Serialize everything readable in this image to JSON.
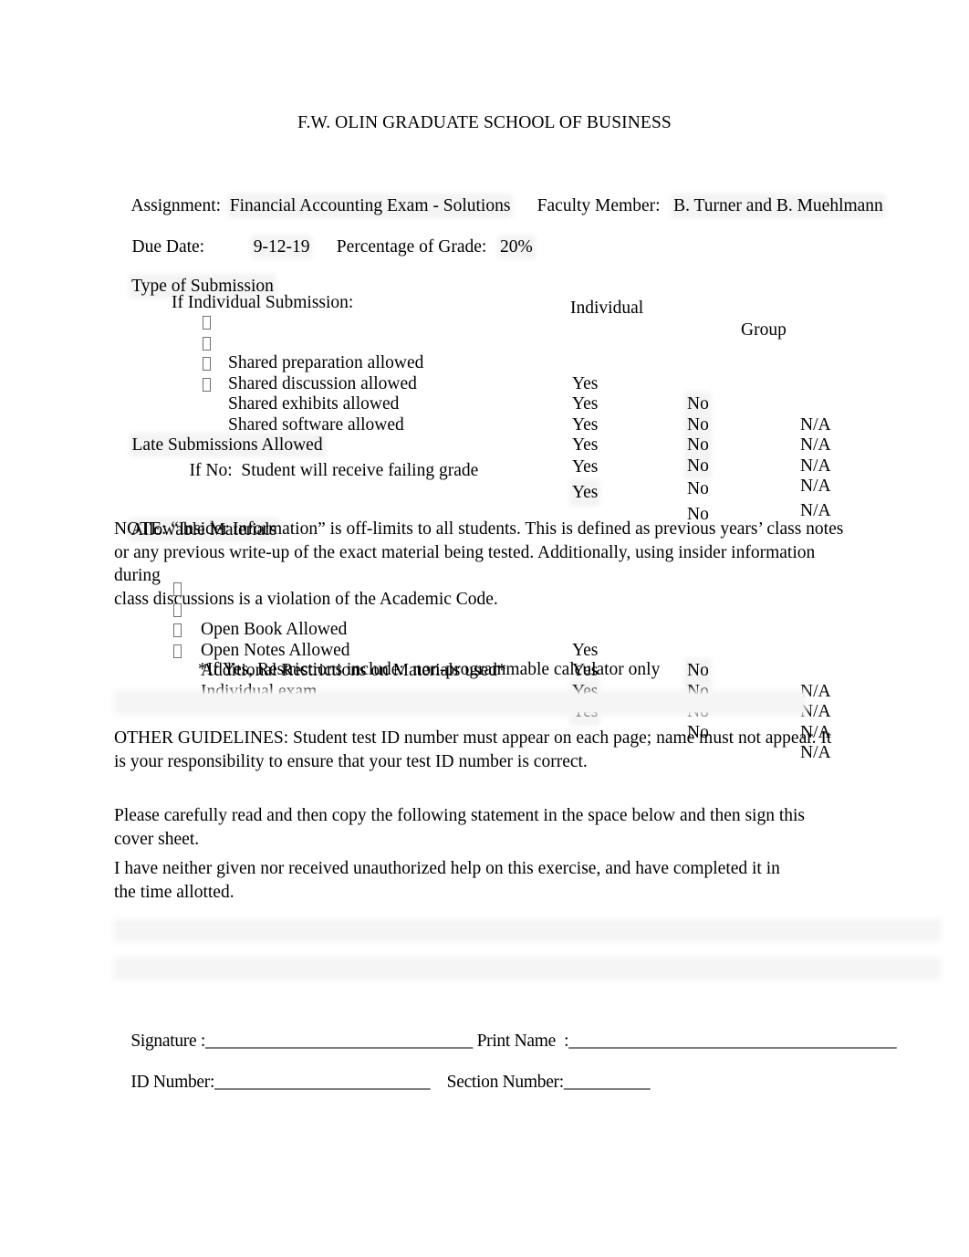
{
  "document": {
    "title": "F.W. OLIN GRADUATE SCHOOL OF BUSINESS"
  },
  "header_fields": {
    "assignment_label": "Assignment:",
    "assignment_value": "Financial Accounting Exam - Solutions",
    "faculty_label": "Faculty Member:",
    "faculty_value": "B. Turner and B. Muehlmann",
    "due_date_label": "Due Date:",
    "due_date_value": "9-12-19",
    "percentage_label": "Percentage of Grade:",
    "percentage_value": "20%"
  },
  "submission": {
    "type_label": "Type of Submission",
    "individual_header": "Individual",
    "group_header": "Group",
    "if_individual_label": "If Individual Submission:",
    "options": [
      "Yes",
      "No",
      "N/A"
    ],
    "items": [
      {
        "label": "Shared preparation allowed",
        "selected": "No"
      },
      {
        "label": "Shared discussion allowed",
        "selected": "No"
      },
      {
        "label": "Shared exhibits allowed",
        "selected": "No"
      },
      {
        "label": "Shared software allowed",
        "selected": "No"
      }
    ]
  },
  "late_submissions": {
    "label": "Late Submissions Allowed",
    "options": [
      "Yes",
      "No",
      "N/A"
    ],
    "selected": "",
    "sub_label": "If No:  Student will receive failing grade",
    "sub_options": [
      "Yes",
      "No"
    ],
    "sub_selected": "Yes"
  },
  "allowable_materials": {
    "heading": "Allowable Materials",
    "note_line1": "NOTE:  “Insider Information” is off-limits to all students.  This is defined as previous years’ class notes",
    "note_line2": "or any previous write-up of the exact material being tested.  Additionally, using insider information during",
    "note_line3": "class discussions is a violation of the Academic Code.",
    "options": [
      "Yes",
      "No",
      "N/A"
    ],
    "items": [
      {
        "label": "Open Book Allowed",
        "selected": "No"
      },
      {
        "label": "Open Notes Allowed",
        "selected": "No"
      },
      {
        "label": "Additional Restrictions on Materials used*",
        "selected": "Yes"
      },
      {
        "label": "Individual exam",
        "selected": "Yes"
      }
    ],
    "restrictions_note": "*If Yes, Restrictions include:  non-programmable calculator only"
  },
  "other_guidelines": {
    "line1": "OTHER GUIDELINES:     Student test ID number must appear on each page; name must not appear.    It",
    "line2": "is your responsibility to ensure that your test ID number is correct."
  },
  "honor_statement": {
    "instruction_line1": "Please carefully read and then copy the following statement in the space below and then sign this",
    "instruction_line2": "cover sheet.",
    "statement_line1": "I have neither given nor received unauthorized help on this exercise, and have completed it in",
    "statement_line2": "the time allotted."
  },
  "signature_block": {
    "signature_label": "Signature :",
    "signature_rule": "_______________________________",
    "print_name_label": "Print Name  :",
    "print_name_rule": "______________________________________",
    "id_number_label": "ID Number:",
    "id_number_rule": "_________________________",
    "section_number_label": "Section Number:",
    "section_number_rule": "__________"
  },
  "colors": {
    "text": "#000000",
    "page_background": "#ffffff",
    "highlight": "#f4f4f4",
    "bullet_outline": "#6f6f6f"
  }
}
